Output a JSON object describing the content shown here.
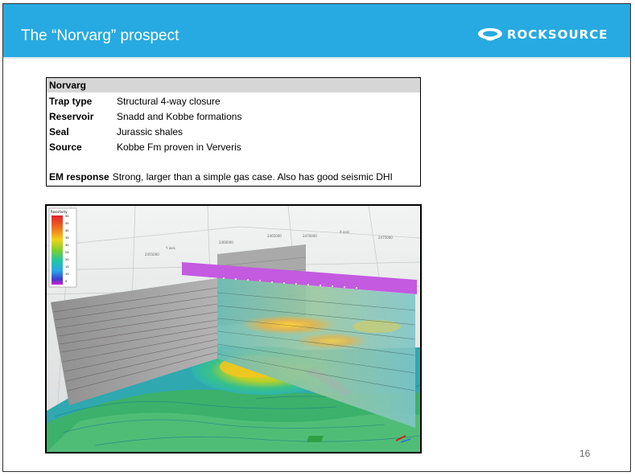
{
  "header": {
    "title": "The “Norvarg” prospect",
    "brand": "ROCKSOURCE",
    "colors": {
      "bar": "#27aae1",
      "text": "#ffffff"
    }
  },
  "table": {
    "heading": "Norvarg",
    "rows": [
      {
        "label": "Trap type",
        "value": "Structural 4-way closure"
      },
      {
        "label": "Reservoir",
        "value": "Snadd and Kobbe formations"
      },
      {
        "label": "Seal",
        "value": "Jurassic shales"
      },
      {
        "label": "Source",
        "value": "Kobbe Fm proven in Ververis"
      },
      {
        "label": "EM response",
        "value": "Strong, larger than a simple gas case. Also has good seismic DHI"
      }
    ]
  },
  "figure": {
    "legend_title": "Resistivity",
    "legend_ticks": [
      "50",
      "45",
      "40",
      "35",
      "30",
      "25",
      "20",
      "15",
      "10",
      "5"
    ]
  },
  "page_number": "16"
}
